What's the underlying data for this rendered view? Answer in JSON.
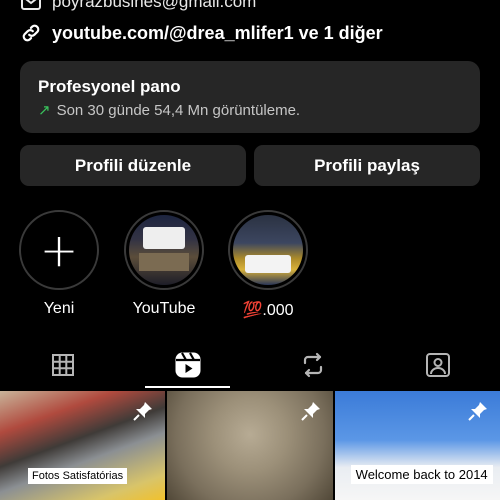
{
  "profile": {
    "email": "poyrazbusines@gmail.com",
    "link": "youtube.com/@drea_mlifer1 ve 1 diğer"
  },
  "dashboard": {
    "title": "Profesyonel pano",
    "subtitle": "Son 30 günde 54,4 Mn görüntüleme.",
    "accent": "#39c25c"
  },
  "buttons": {
    "edit_label": "Profili düzenle",
    "share_label": "Profili paylaş"
  },
  "highlights": [
    {
      "label": "Yeni",
      "icon": "plus-icon"
    },
    {
      "label": "YouTube"
    },
    {
      "label": "💯.000"
    }
  ],
  "tabs": [
    {
      "icon": "grid-icon",
      "active": false
    },
    {
      "icon": "reels-icon",
      "active": true
    },
    {
      "icon": "reposts-icon",
      "active": false
    },
    {
      "icon": "tagged-icon",
      "active": false
    }
  ],
  "posts": [
    {
      "caption": "Fotos Satisfatórias",
      "pinned": true
    },
    {
      "caption": "",
      "pinned": true
    },
    {
      "caption": "Welcome back to 2014",
      "pinned": true
    }
  ],
  "colors": {
    "background": "#000000",
    "card": "#262626",
    "text": "#ffffff"
  }
}
